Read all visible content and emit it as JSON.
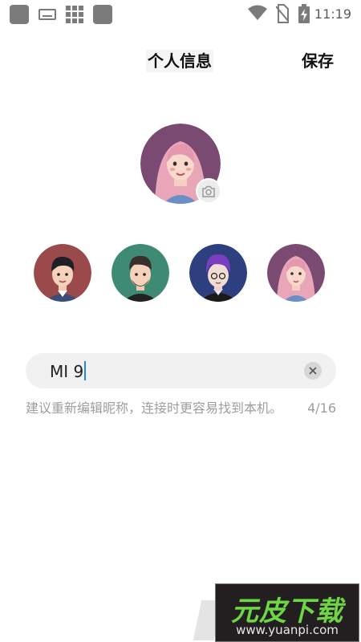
{
  "status_bar": {
    "time": "11:19",
    "icons": [
      "app-square-icon",
      "keyboard-icon",
      "grid-icon",
      "app-square-icon",
      "wifi-icon",
      "no-sim-icon",
      "battery-charging-icon"
    ]
  },
  "header": {
    "title": "个人信息",
    "save_label": "保存"
  },
  "profile": {
    "selected_avatar": 4,
    "avatars": [
      {
        "name": "avatar-male-black-hair",
        "bg": "#9a4a4a"
      },
      {
        "name": "avatar-male-beard",
        "bg": "#3e8a72"
      },
      {
        "name": "avatar-purple-hair",
        "bg": "#2e3f80"
      },
      {
        "name": "avatar-female-pink-hair",
        "bg": "#7b4a73"
      }
    ]
  },
  "nickname": {
    "value": "MI 9",
    "hint": "建议重新编辑昵称，连接时更容易找到本机。",
    "counter": "4/16"
  },
  "watermark": {
    "title": "元皮下载",
    "url": "www.yuanpi.com"
  },
  "colors": {
    "accent": "#1e88e5",
    "hint_text": "#9e9e9e",
    "watermark_green": "#6ed644"
  }
}
